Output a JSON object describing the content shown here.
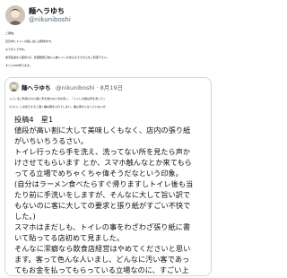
{
  "author": {
    "name": "麺へラゆち",
    "handle": "@nikuniboshi"
  },
  "post_lines": [
    "ご報告。",
    "近日中にトイレの貼し出しは辞めます。",
    "もうダメですね。",
    "素手乱舞から徒歩1分、武里駅西口前に公衆トイレがあるのでそちらをご利用下さい。",
    "すぐにPOP作ります。"
  ],
  "quoted": {
    "name": "麺へラゆち",
    "handle": "@nikuniboshi",
    "date": "8月19日",
    "text_lines": [
      "トイレをご利用された後に手を洗わない方が多く、「トイレの後は手を洗ってく",
      "ださい」とお伝えすると凄く嫌な顔をされてしまい、誰も幸せになっていないの",
      "で、そろそろトイレの貸出自体を辞めるか検討中です。"
    ],
    "image_lines": [
      "投稿4　星1",
      "値段が高い割に大して美味しくもなく、店内の張り紙",
      "がいちいちうるさい。",
      "トイレ行ったら手を洗え、洗ってない所を見たら声か",
      "けさせてもらいます とか、スマホ触んなとか来てもら",
      "ってる立場でめちゃくちゃ偉そうだなという印象。",
      "(自分はラーメン食べたらすぐ帰りますしトイレ後も当",
      "たり前に手洗いをしますが、そんなに大して旨い訳で",
      "もないのに客に大しての要求と張り紙がすごい不快で",
      "した。)",
      "スマホはまだしも、トイレの事をわざわざ張り紙に書",
      "いて貼ってる店初めて見ました。",
      "そんなに潔癖なら飲食店経営はやめてくださいと思い",
      "ます。客って色んな人いまし、どんなに汚い客であっ",
      "てもお金を払ってもらっている立場なのに、すごい上"
    ]
  },
  "colors": {
    "text": "#0f1419",
    "secondary": "#536471",
    "border": "#cfd9de"
  }
}
